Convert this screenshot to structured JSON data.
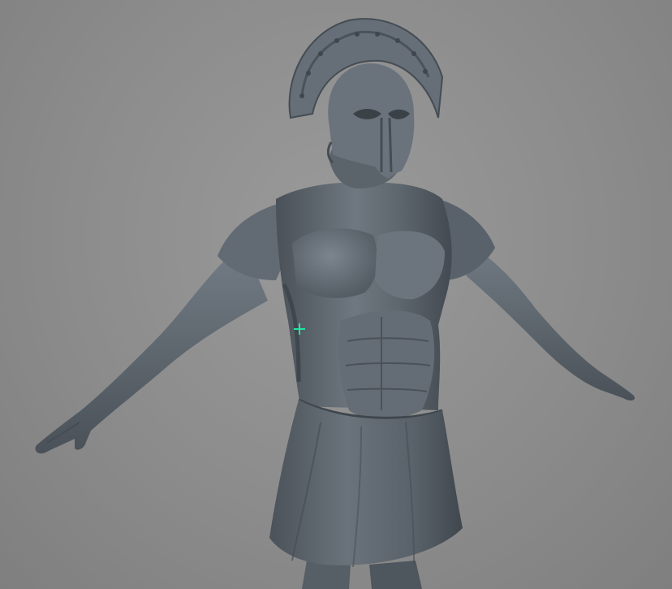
{
  "viewport": {
    "background_color": "#8f8f8f",
    "model_color": "#5d656d",
    "model_highlight_color": "#7a838c",
    "model_shadow_color": "#3e454c",
    "pivot_marker_color": "#1ee6a0"
  },
  "model": {
    "icon": "warrior-3d-model",
    "parts": [
      "helmet-crest",
      "helmet",
      "torso-armor",
      "left-arm",
      "right-arm",
      "skirt",
      "legs"
    ]
  }
}
